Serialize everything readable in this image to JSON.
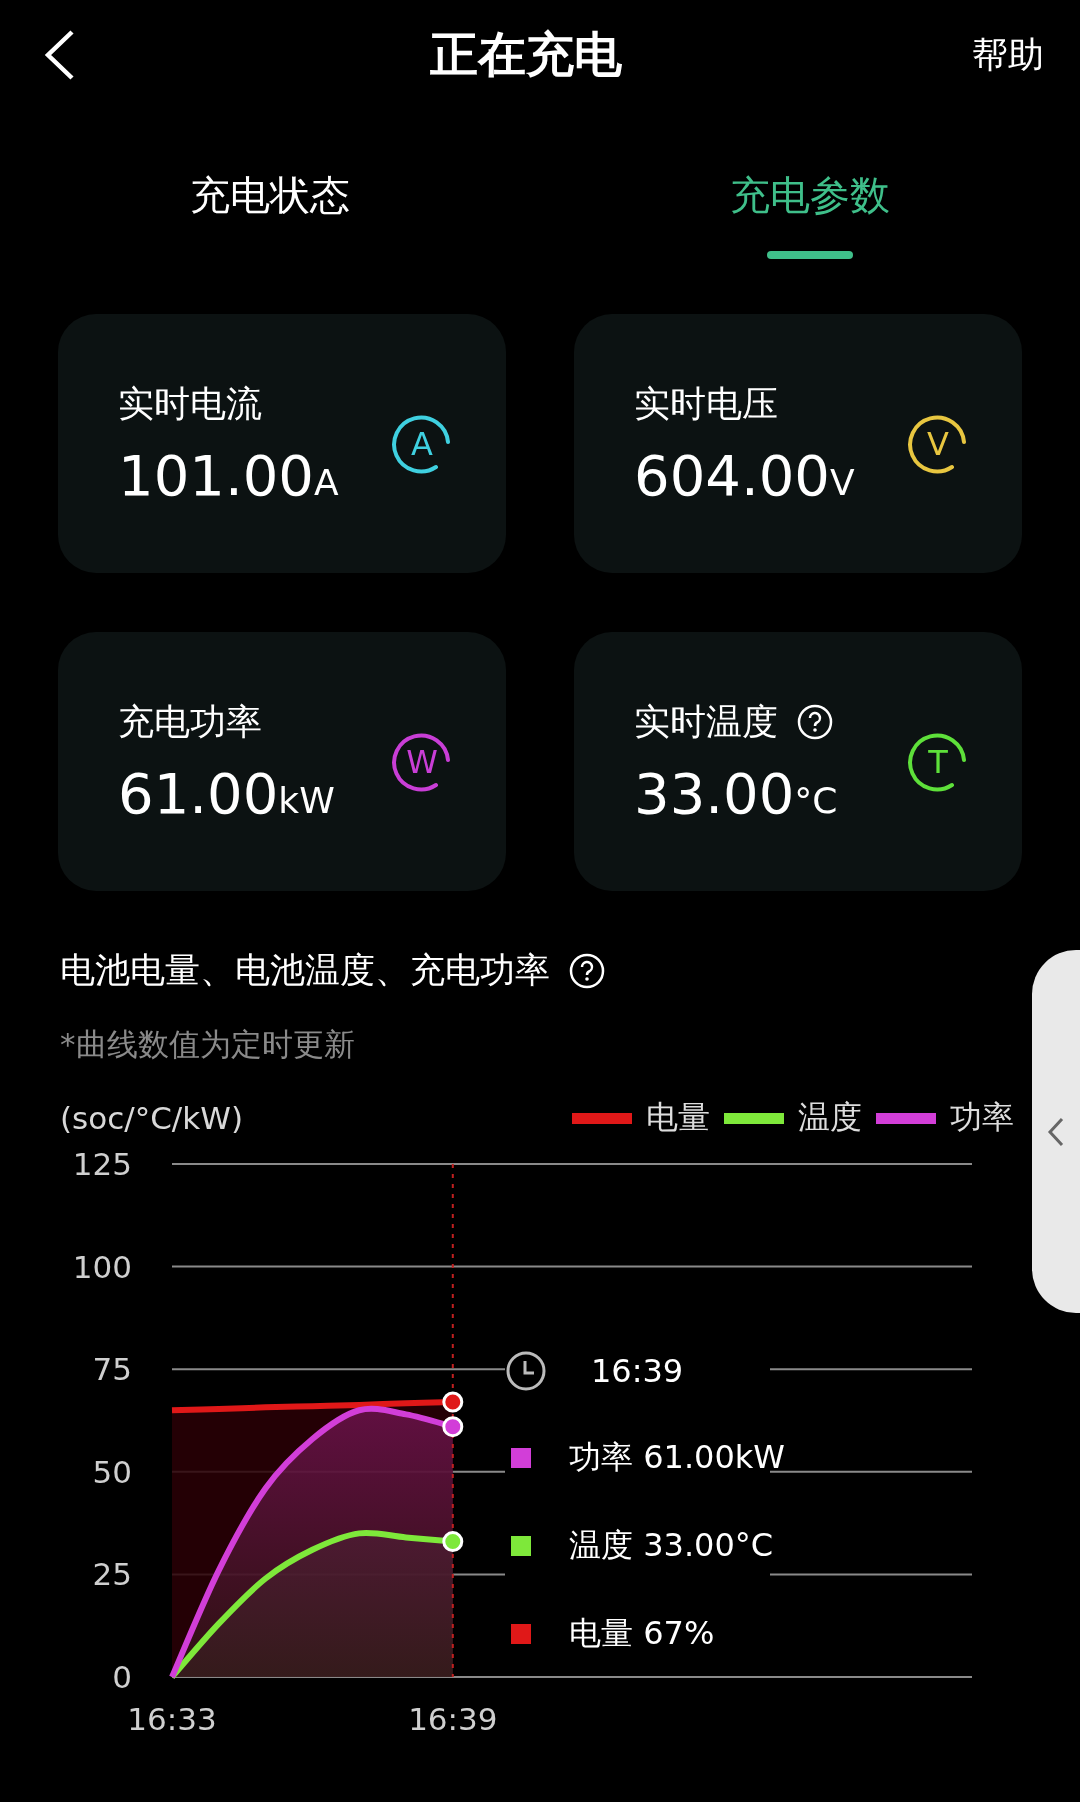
{
  "header": {
    "title": "正在充电",
    "help": "帮助"
  },
  "tabs": [
    {
      "label": "充电状态",
      "selected": false
    },
    {
      "label": "充电参数",
      "selected": true
    }
  ],
  "cards": [
    {
      "label": "实时电流",
      "value": "101.00",
      "unit": "A",
      "icon_text": "A",
      "color": "#3fd0e0",
      "help": false
    },
    {
      "label": "实时电压",
      "value": "604.00",
      "unit": "V",
      "icon_text": "V",
      "color": "#e8c640",
      "help": false
    },
    {
      "label": "充电功率",
      "value": "61.00",
      "unit": "kW",
      "icon_text": "W",
      "color": "#c93ed6",
      "help": false
    },
    {
      "label": "实时温度",
      "value": "33.00",
      "unit": "°C",
      "icon_text": "T",
      "color": "#5ee03a",
      "help": true
    }
  ],
  "chart_section": {
    "title": "电池电量、电池温度、充电功率",
    "note": "*曲线数值为定时更新",
    "unit_label": "(soc/°C/kW)",
    "tooltip": {
      "time": "16:39",
      "rows": [
        {
          "label": "功率 61.00kW",
          "color": "#d23ed8"
        },
        {
          "label": "温度 33.00°C",
          "color": "#7ee83a"
        },
        {
          "label": "电量 67%",
          "color": "#e01818"
        }
      ]
    },
    "chart_data": {
      "type": "area",
      "grid": true,
      "categories": [
        "16:33",
        null,
        null,
        null,
        null,
        null,
        "16:39"
      ],
      "ylim": [
        0,
        125
      ],
      "yticks": [
        0,
        25,
        50,
        75,
        100,
        125
      ],
      "series": [
        {
          "name": "电量",
          "color": "#e01818",
          "values": [
            65,
            65.3,
            65.7,
            66,
            66.3,
            66.7,
            67
          ]
        },
        {
          "name": "温度",
          "color": "#7ee83a",
          "values": [
            0,
            13,
            24,
            31,
            35,
            34,
            33
          ]
        },
        {
          "name": "功率",
          "color": "#d23ed8",
          "values": [
            0,
            26,
            46,
            58,
            65,
            64,
            61
          ]
        }
      ]
    }
  }
}
